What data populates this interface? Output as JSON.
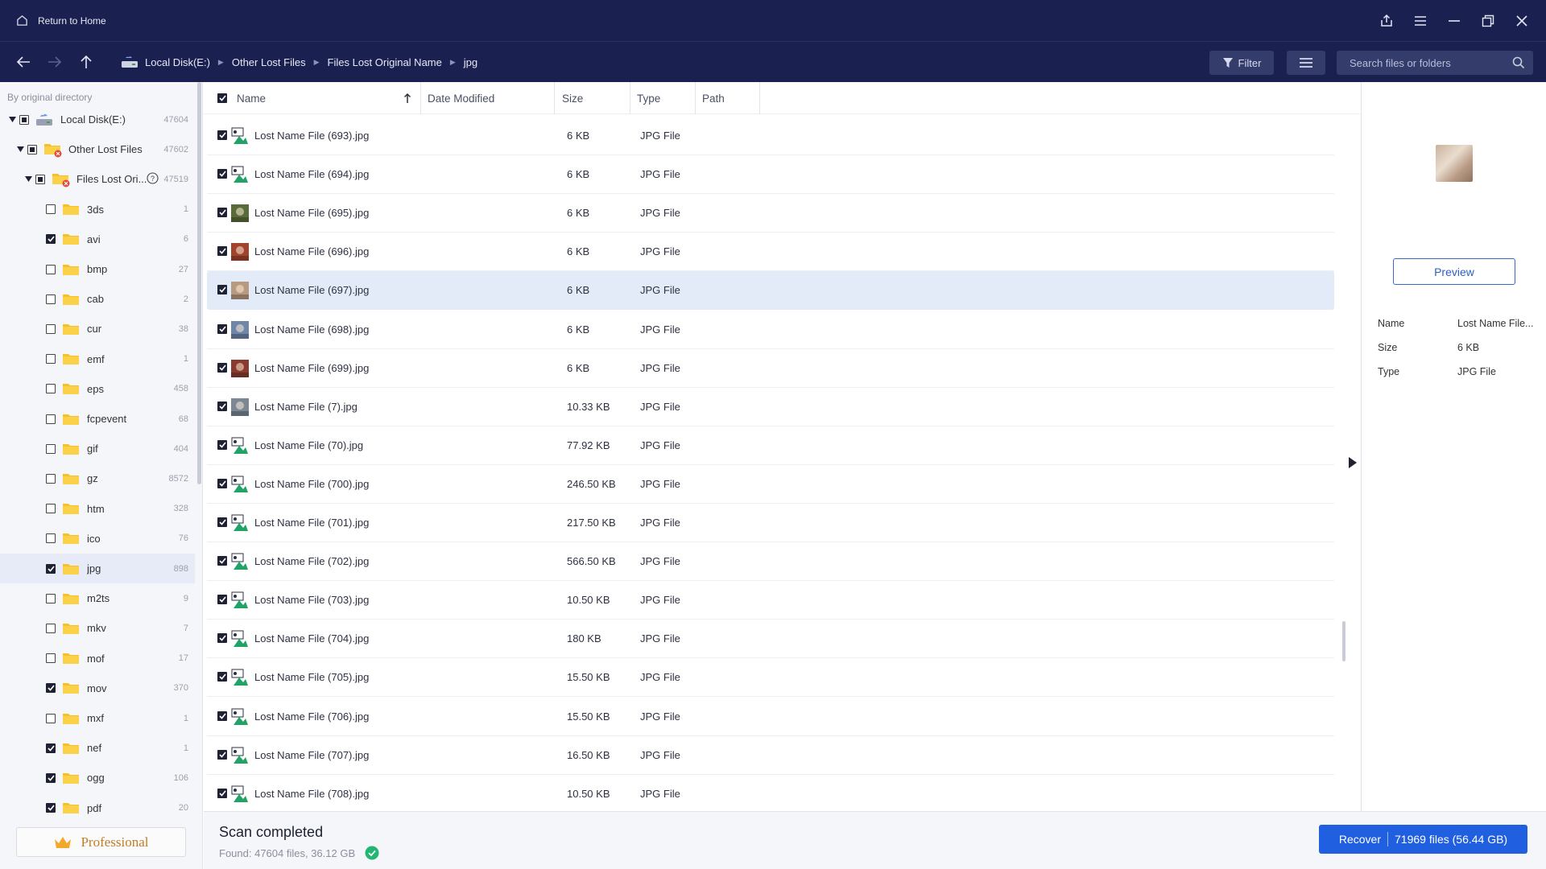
{
  "titlebar": {
    "home_label": "Return to Home"
  },
  "breadcrumb": [
    "Local Disk(E:)",
    "Other Lost Files",
    "Files Lost Original Name",
    "jpg"
  ],
  "toolbar": {
    "filter_label": "Filter",
    "search_placeholder": "Search files or folders"
  },
  "sidebar": {
    "heading": "By original directory",
    "tree": [
      {
        "label": "Local Disk(E:)",
        "count": "47604",
        "level": 0,
        "expanded": true,
        "state": "partial",
        "icon": "drive-icon"
      },
      {
        "label": "Other Lost Files",
        "count": "47602",
        "level": 1,
        "expanded": true,
        "state": "partial",
        "icon": "lost-folder-icon"
      },
      {
        "label": "Files Lost Ori...",
        "count": "47519",
        "level": 2,
        "expanded": true,
        "state": "partial",
        "icon": "lost-folder-icon",
        "help": true
      },
      {
        "label": "3ds",
        "count": "1",
        "level": 3,
        "state": "unchecked"
      },
      {
        "label": "avi",
        "count": "6",
        "level": 3,
        "state": "checked"
      },
      {
        "label": "bmp",
        "count": "27",
        "level": 3,
        "state": "unchecked"
      },
      {
        "label": "cab",
        "count": "2",
        "level": 3,
        "state": "unchecked"
      },
      {
        "label": "cur",
        "count": "38",
        "level": 3,
        "state": "unchecked"
      },
      {
        "label": "emf",
        "count": "1",
        "level": 3,
        "state": "unchecked"
      },
      {
        "label": "eps",
        "count": "458",
        "level": 3,
        "state": "unchecked"
      },
      {
        "label": "fcpevent",
        "count": "68",
        "level": 3,
        "state": "unchecked"
      },
      {
        "label": "gif",
        "count": "404",
        "level": 3,
        "state": "unchecked"
      },
      {
        "label": "gz",
        "count": "8572",
        "level": 3,
        "state": "unchecked"
      },
      {
        "label": "htm",
        "count": "328",
        "level": 3,
        "state": "unchecked"
      },
      {
        "label": "ico",
        "count": "76",
        "level": 3,
        "state": "unchecked"
      },
      {
        "label": "jpg",
        "count": "898",
        "level": 3,
        "state": "checked",
        "selected": true
      },
      {
        "label": "m2ts",
        "count": "9",
        "level": 3,
        "state": "unchecked"
      },
      {
        "label": "mkv",
        "count": "7",
        "level": 3,
        "state": "unchecked"
      },
      {
        "label": "mof",
        "count": "17",
        "level": 3,
        "state": "unchecked"
      },
      {
        "label": "mov",
        "count": "370",
        "level": 3,
        "state": "checked"
      },
      {
        "label": "mxf",
        "count": "1",
        "level": 3,
        "state": "unchecked"
      },
      {
        "label": "nef",
        "count": "1",
        "level": 3,
        "state": "checked"
      },
      {
        "label": "ogg",
        "count": "106",
        "level": 3,
        "state": "checked"
      },
      {
        "label": "pdf",
        "count": "20",
        "level": 3,
        "state": "checked"
      }
    ],
    "pro_label": "Professional"
  },
  "columns": {
    "name": "Name",
    "date": "Date Modified",
    "size": "Size",
    "type": "Type",
    "path": "Path"
  },
  "files": [
    {
      "name": "Lost Name File (693).jpg",
      "size": "6 KB",
      "type": "JPG File",
      "thumb": "image-icon"
    },
    {
      "name": "Lost Name File (694).jpg",
      "size": "6 KB",
      "type": "JPG File",
      "thumb": "image-icon"
    },
    {
      "name": "Lost Name File (695).jpg",
      "size": "6 KB",
      "type": "JPG File",
      "thumb": "photo",
      "color": "#5a6b3a"
    },
    {
      "name": "Lost Name File (696).jpg",
      "size": "6 KB",
      "type": "JPG File",
      "thumb": "photo",
      "color": "#a0442e"
    },
    {
      "name": "Lost Name File (697).jpg",
      "size": "6 KB",
      "type": "JPG File",
      "thumb": "photo",
      "color": "#b89a80",
      "selected": true
    },
    {
      "name": "Lost Name File (698).jpg",
      "size": "6 KB",
      "type": "JPG File",
      "thumb": "photo",
      "color": "#6f86a8"
    },
    {
      "name": "Lost Name File (699).jpg",
      "size": "6 KB",
      "type": "JPG File",
      "thumb": "photo",
      "color": "#8a3b2f"
    },
    {
      "name": "Lost Name File (7).jpg",
      "size": "10.33 KB",
      "type": "JPG File",
      "thumb": "photo",
      "color": "#7b8894"
    },
    {
      "name": "Lost Name File (70).jpg",
      "size": "77.92 KB",
      "type": "JPG File",
      "thumb": "image-icon"
    },
    {
      "name": "Lost Name File (700).jpg",
      "size": "246.50 KB",
      "type": "JPG File",
      "thumb": "image-icon"
    },
    {
      "name": "Lost Name File (701).jpg",
      "size": "217.50 KB",
      "type": "JPG File",
      "thumb": "image-icon"
    },
    {
      "name": "Lost Name File (702).jpg",
      "size": "566.50 KB",
      "type": "JPG File",
      "thumb": "image-icon"
    },
    {
      "name": "Lost Name File (703).jpg",
      "size": "10.50 KB",
      "type": "JPG File",
      "thumb": "image-icon"
    },
    {
      "name": "Lost Name File (704).jpg",
      "size": "180 KB",
      "type": "JPG File",
      "thumb": "image-icon"
    },
    {
      "name": "Lost Name File (705).jpg",
      "size": "15.50 KB",
      "type": "JPG File",
      "thumb": "image-icon"
    },
    {
      "name": "Lost Name File (706).jpg",
      "size": "15.50 KB",
      "type": "JPG File",
      "thumb": "image-icon"
    },
    {
      "name": "Lost Name File (707).jpg",
      "size": "16.50 KB",
      "type": "JPG File",
      "thumb": "image-icon"
    },
    {
      "name": "Lost Name File (708).jpg",
      "size": "10.50 KB",
      "type": "JPG File",
      "thumb": "image-icon"
    }
  ],
  "details": {
    "preview_label": "Preview",
    "fields": [
      {
        "key": "Name",
        "value": "Lost Name File..."
      },
      {
        "key": "Size",
        "value": "6 KB"
      },
      {
        "key": "Type",
        "value": "JPG File"
      }
    ]
  },
  "status": {
    "title": "Scan completed",
    "found": "Found: 47604 files, 36.12 GB",
    "recover_label": "Recover",
    "recover_count": "71969 files (56.44 GB)"
  },
  "colors": {
    "titlebar": "#1a2150",
    "accent": "#1f5fe0",
    "success": "#22b573",
    "folder": "#f6c026"
  }
}
